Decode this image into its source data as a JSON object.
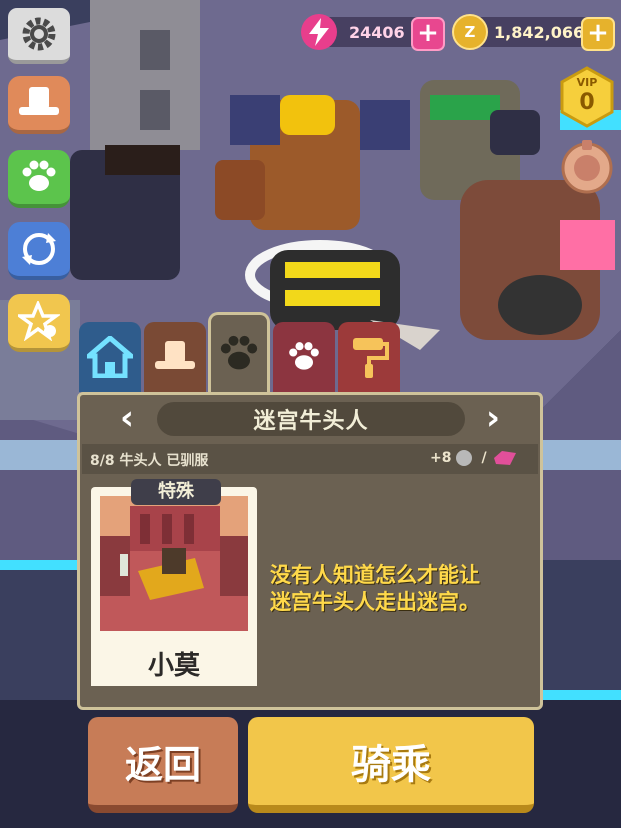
{
  "currency": {
    "energy_value": "24406",
    "energy_icon": "lightning-icon",
    "coins_value": "1,842,066",
    "coin_icon": "coin-icon",
    "plus": "+"
  },
  "vip": {
    "label": "VIP",
    "level": "0"
  },
  "left_menu": [
    {
      "icon": "gear-icon"
    },
    {
      "icon": "cowboy-hat-icon"
    },
    {
      "icon": "paw-icon"
    },
    {
      "icon": "exchange-icon"
    },
    {
      "icon": "star-badge-icon"
    }
  ],
  "tabs": [
    {
      "icon": "home-icon",
      "active": false
    },
    {
      "icon": "cowboy-hat-icon",
      "active": false
    },
    {
      "icon": "paw-icon",
      "active": true
    },
    {
      "icon": "paw-icon",
      "active": false
    },
    {
      "icon": "paint-roller-icon",
      "active": false
    }
  ],
  "panel": {
    "title": "迷宫牛头人",
    "prev_arrow": "‹",
    "next_arrow": "›",
    "tamed_text": "8/8 牛头人 已驯服",
    "reward_text": "+8",
    "reward_separator": "/",
    "card_tag": "特殊",
    "card_name": "小莫",
    "description_line1": "没有人知道怎么才能让",
    "description_line2": "迷宫牛头人走出迷宫。"
  },
  "buttons": {
    "back": "返回",
    "ride": "骑乘"
  },
  "colors": {
    "energy": "#e83e8c",
    "coin": "#e6b22c",
    "panel": "#6b6152",
    "description": "#ffd94a",
    "back_button": "#c77c57",
    "ride_button": "#f2c64a"
  }
}
